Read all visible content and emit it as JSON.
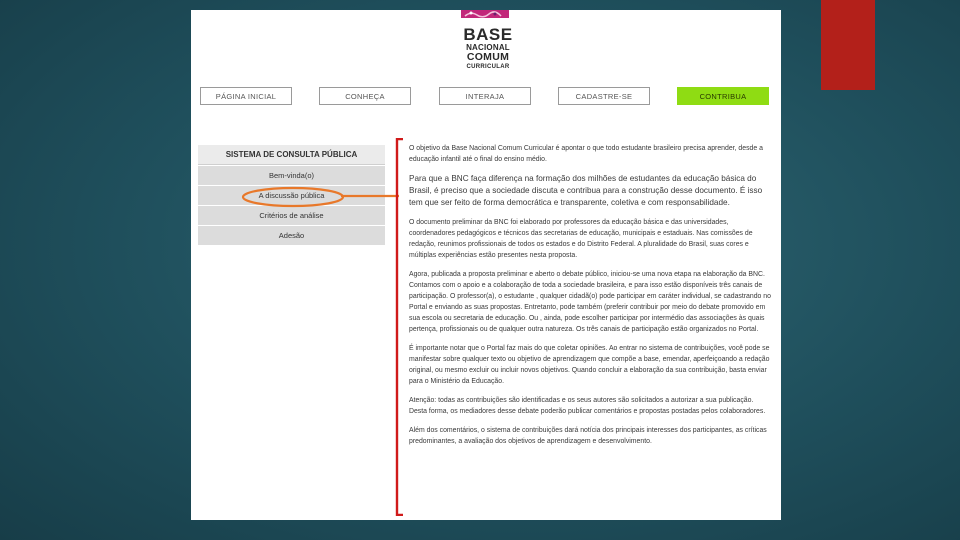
{
  "logo": {
    "line1": "BASE",
    "line2": "NACIONAL",
    "line3": "COMUM",
    "line4": "CURRICULAR"
  },
  "nav": {
    "items": [
      {
        "label": "PÁGINA INICIAL"
      },
      {
        "label": "CONHEÇA"
      },
      {
        "label": "INTERAJA"
      },
      {
        "label": "CADASTRE-SE"
      },
      {
        "label": "CONTRIBUA"
      }
    ]
  },
  "sidebar": {
    "title": "SISTEMA DE CONSULTA PÚBLICA",
    "items": [
      {
        "label": "Bem-vinda(o)"
      },
      {
        "label": "A discussão pública"
      },
      {
        "label": "Critérios de análise"
      },
      {
        "label": "Adesão"
      }
    ]
  },
  "content": {
    "paragraphs": [
      "O objetivo da Base Nacional Comum Curricular é apontar o que todo estudante brasileiro precisa aprender, desde a educação infantil até o final do ensino médio.",
      "Para que a BNC faça diferença na formação dos milhões de estudantes da educação básica do Brasil, é preciso que a sociedade discuta e contribua para a construção desse documento. É isso tem que ser feito de forma democrática e transparente, coletiva e com responsabilidade.",
      "O documento preliminar da BNC foi elaborado por professores da educação básica e das universidades, coordenadores pedagógicos e técnicos das secretarias de educação, municipais e estaduais. Nas comissões de redação, reunimos profissionais de todos os estados e do Distrito Federal. A pluralidade do Brasil, suas cores e múltiplas experiências estão presentes nesta proposta.",
      "Agora, publicada a proposta preliminar e aberto o debate público, iniciou-se uma nova etapa na elaboração da BNC. Contamos com o apoio e a colaboração de toda a sociedade brasileira, e para isso estão disponíveis três canais de participação. O professor(a), o estudante , qualquer cidadã(o) pode participar em caráter individual, se cadastrando no Portal e enviando as suas propostas. Entretanto, pode também (preferir contribuir por meio do debate promovido em sua escola ou secretaria de educação. Ou , ainda, pode escolher participar por intermédio das associações às quais pertença, profissionais ou de qualquer outra natureza. Os três canais de participação estão organizados no Portal.",
      "É importante notar que o Portal faz mais do que coletar opiniões. Ao entrar no sistema de contribuições, você pode se manifestar sobre qualquer texto ou objetivo de aprendizagem que compõe a base, emendar, aperfeiçoando a redação original, ou mesmo excluir ou incluir novos objetivos. Quando concluir a elaboração da sua contribuição, basta enviar para o Ministério da Educação.",
      "Atenção: todas as contribuições são identificadas e os seus autores são solicitados a autorizar a sua publicação. Desta forma, os mediadores desse debate poderão publicar comentários e propostas postadas pelos colaboradores.",
      "Além dos comentários, o sistema de contribuições dará notícia dos principais interesses dos participantes, as críticas predominantes, a avaliação dos objetivos de aprendizagem e desenvolvimento."
    ]
  },
  "colors": {
    "accent_red": "#b3201a",
    "nav_active": "#8fdc13",
    "highlight_orange": "#e8782a",
    "bracket_red": "#d01a1a"
  }
}
